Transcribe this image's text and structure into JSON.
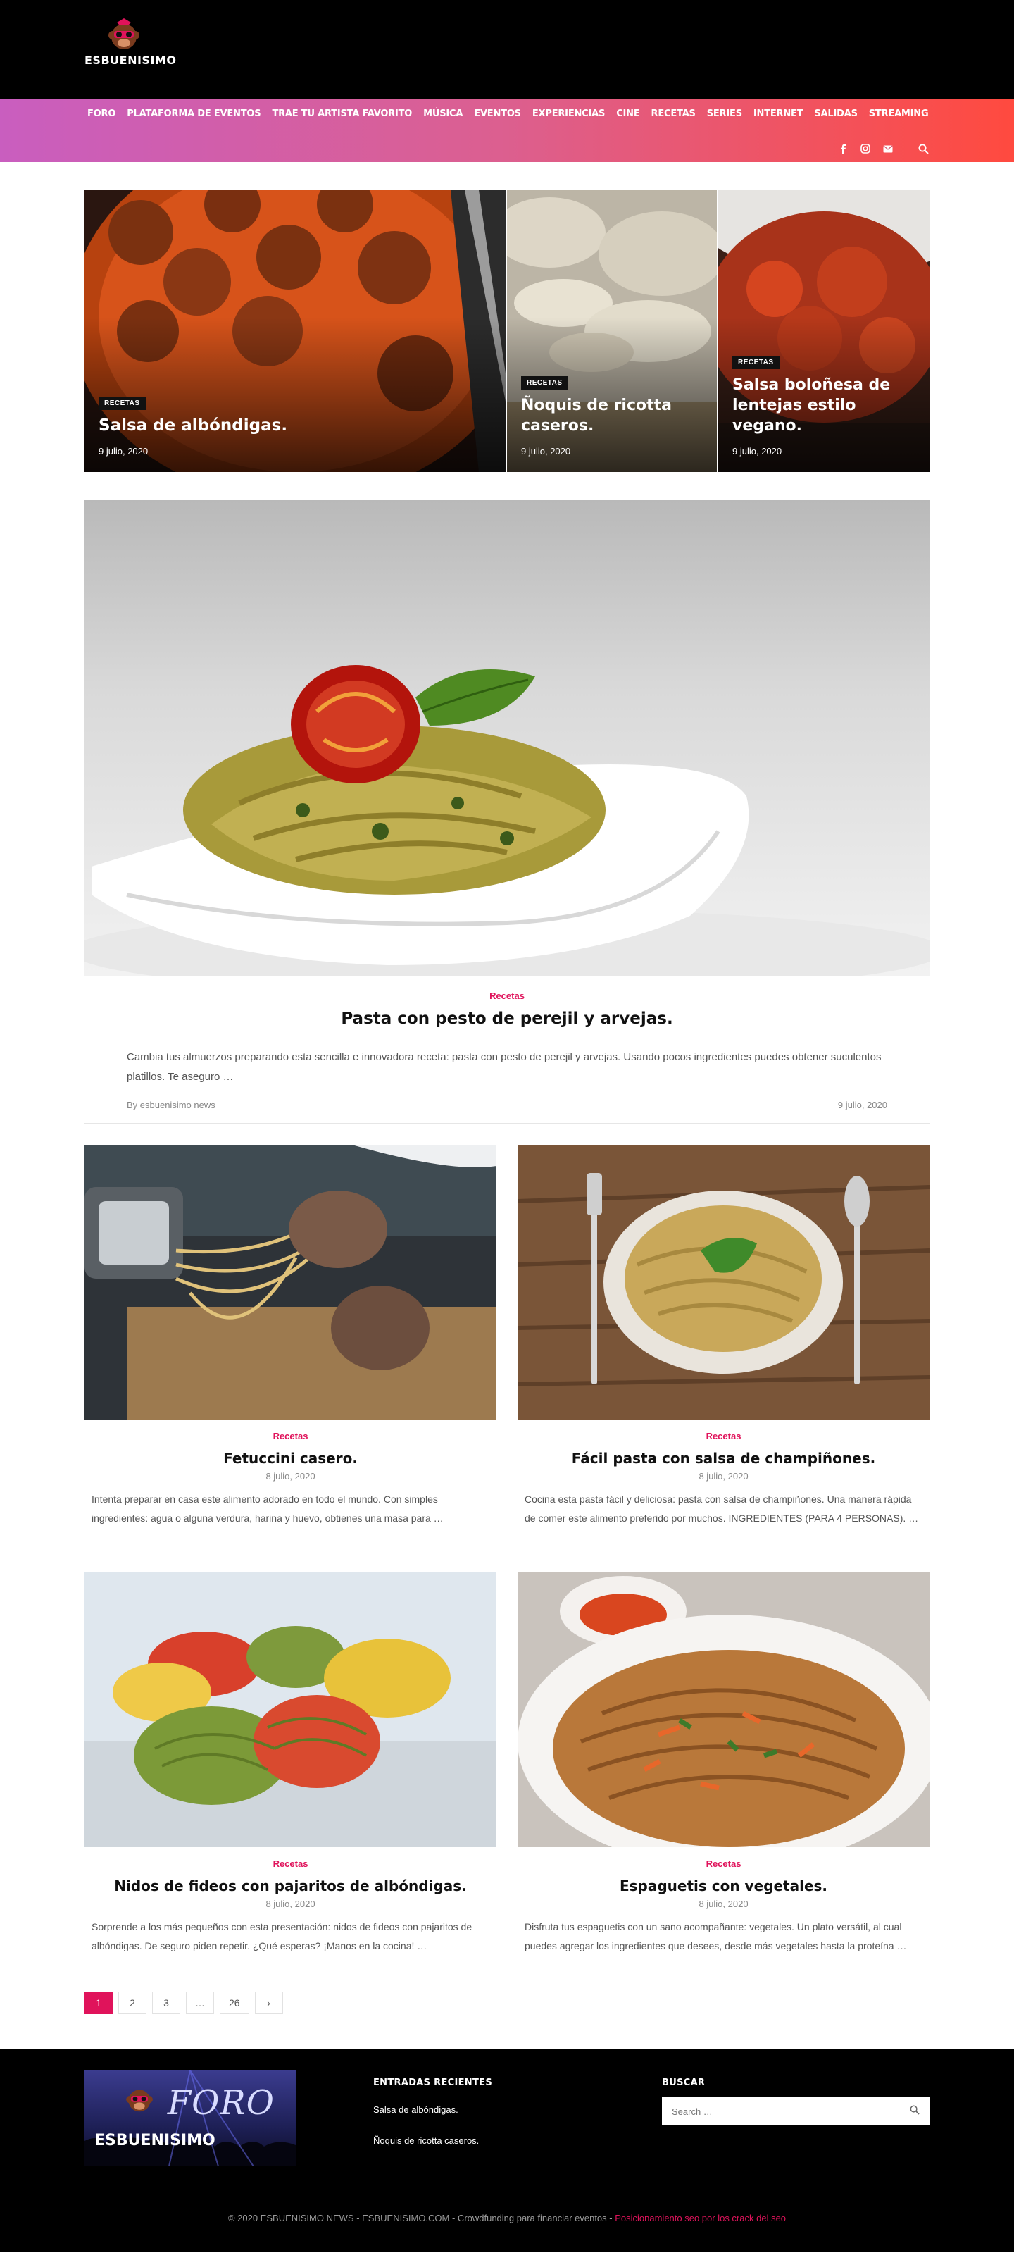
{
  "header": {
    "logo_text": "ESBUENISIMO",
    "nav": [
      "FORO",
      "PLATAFORMA DE EVENTOS",
      "TRAE TU ARTISTA FAVORITO",
      "MÚSICA",
      "EVENTOS",
      "EXPERIENCIAS",
      "CINE",
      "RECETAS",
      "SERIES",
      "INTERNET",
      "SALIDAS",
      "STREAMING"
    ],
    "icons": [
      "facebook-icon",
      "instagram-icon",
      "mail-icon",
      "search-icon"
    ]
  },
  "featured": [
    {
      "badge": "RECETAS",
      "title": "Salsa de albóndigas.",
      "date": "9 julio, 2020"
    },
    {
      "badge": "RECETAS",
      "title": "Ñoquis de ricotta caseros.",
      "date": "9 julio, 2020"
    },
    {
      "badge": "RECETAS",
      "title": "Salsa boloñesa de lentejas estilo vegano.",
      "date": "9 julio, 2020"
    }
  ],
  "main_post": {
    "category": "Recetas",
    "title": "Pasta con pesto de perejil y arvejas.",
    "excerpt": "Cambia tus almuerzos preparando esta sencilla e innovadora receta: pasta con pesto de perejil y arvejas. Usando pocos ingredientes puedes obtener suculentos platillos. Te aseguro …",
    "author": "By esbuenisimo news",
    "date": "9 julio, 2020"
  },
  "posts": [
    {
      "category": "Recetas",
      "title": "Fetuccini casero.",
      "date": "8 julio, 2020",
      "excerpt": "Intenta preparar en casa este alimento adorado en todo el mundo. Con simples ingredientes: agua o alguna verdura, harina y huevo, obtienes una masa para …"
    },
    {
      "category": "Recetas",
      "title": "Fácil pasta con salsa de champiñones.",
      "date": "8 julio, 2020",
      "excerpt": "Cocina esta pasta fácil y deliciosa: pasta con salsa de champiñones. Una manera rápida de comer este alimento preferido por muchos. INGREDIENTES (PARA 4 PERSONAS). …"
    },
    {
      "category": "Recetas",
      "title": "Nidos de fideos con pajaritos de albóndigas.",
      "date": "8 julio, 2020",
      "excerpt": "Sorprende a los más pequeños con esta presentación: nidos de fideos con pajaritos de albóndigas. De seguro piden repetir. ¿Qué esperas? ¡Manos en la cocina! …"
    },
    {
      "category": "Recetas",
      "title": "Espaguetis con vegetales.",
      "date": "8 julio, 2020",
      "excerpt": "Disfruta tus espaguetis con un sano acompañante: vegetales. Un plato versátil, al cual puedes agregar los ingredientes que desees, desde más vegetales hasta la proteína …"
    }
  ],
  "pagination": [
    "1",
    "2",
    "3",
    "…",
    "26",
    "›"
  ],
  "footer": {
    "foro_word": "FORO",
    "foro_brand": "ESBUENISIMO",
    "recent_title": "ENTRADAS RECIENTES",
    "recent": [
      "Salsa de albóndigas.",
      "Ñoquis de ricotta caseros."
    ],
    "search_title": "BUSCAR",
    "search_placeholder": "Search …",
    "copyright": "© 2020 ESBUENISIMO NEWS - ESBUENISIMO.COM - Crowdfunding para financiar eventos   -",
    "seo_link": "Posicionamiento seo por los crack del seo"
  },
  "colors": {
    "accent": "#e0135b",
    "nav_gradient_start": "#c95ebf",
    "nav_gradient_end": "#ff4a3f"
  }
}
